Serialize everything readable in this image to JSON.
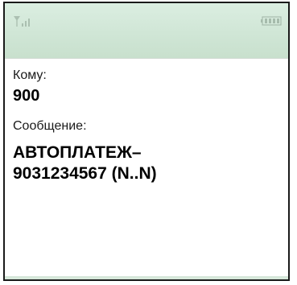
{
  "status_bar": {
    "signal_icon": "signal-icon",
    "battery_icon": "battery-icon",
    "colors": {
      "bar_top": "#dbeee1",
      "bar_bottom": "#c8e0cd"
    }
  },
  "compose": {
    "to_label": "Кому:",
    "to_value": "900",
    "message_label": "Сообщение:",
    "message_body": "АВТОПЛАТЕЖ–\n9031234567 (N..N)"
  }
}
